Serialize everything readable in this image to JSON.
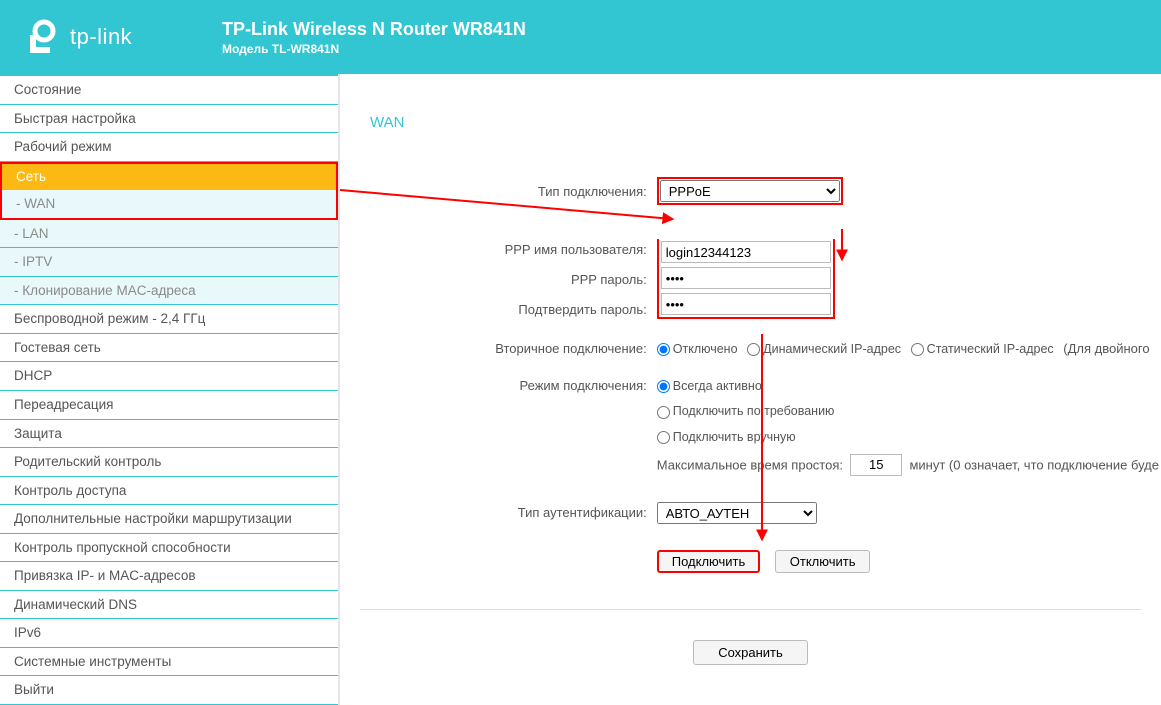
{
  "brand": {
    "logo_text": "tp-link"
  },
  "header": {
    "title": "TP-Link Wireless N Router WR841N",
    "subtitle": "Модель TL-WR841N"
  },
  "sidebar": {
    "items": {
      "status": "Состояние",
      "quick": "Быстрая настройка",
      "mode": "Рабочий режим",
      "net": "Сеть",
      "wan": "- WAN",
      "lan": "- LAN",
      "iptv": "- IPTV",
      "macclone": "- Клонирование MAC-адреса",
      "wireless": "Беспроводной режим - 2,4 ГГц",
      "guest": "Гостевая сеть",
      "dhcp": "DHCP",
      "fwd": "Переадресация",
      "sec": "Защита",
      "parent": "Родительский контроль",
      "access": "Контроль доступа",
      "route": "Дополнительные настройки маршрутизации",
      "bw": "Контроль пропускной способности",
      "bind": "Привязка IP- и MAC-адресов",
      "ddns": "Динамический DNS",
      "ipv6": "IPv6",
      "tools": "Системные инструменты",
      "logout": "Выйти"
    }
  },
  "wan": {
    "heading": "WAN",
    "labels": {
      "conn_type": "Тип подключения:",
      "ppp_user": "PPP имя пользователя:",
      "ppp_pass": "PPP пароль:",
      "ppp_conf": "Подтвердить пароль:",
      "secondary": "Вторичное подключение:",
      "conn_mode": "Режим подключения:",
      "idle": "Максимальное время простоя:",
      "idle_unit": "минут (0 означает, что подключение буде",
      "auth": "Тип аутентификации:"
    },
    "fields": {
      "conn_type_value": "PPPoE",
      "ppp_user_value": "login12344123",
      "ppp_pass_value": "••••",
      "ppp_conf_value": "••••",
      "idle_value": "15",
      "auth_value": "АВТО_АУТЕН"
    },
    "secondary_opts": {
      "off": "Отключено",
      "dyn": "Динамический IP-адрес",
      "stat": "Статический IP-адрес",
      "extra": "(Для двойного"
    },
    "mode_opts": {
      "always": "Всегда активно",
      "demand": "Подключить по требованию",
      "manual": "Подключить вручную"
    },
    "buttons": {
      "connect": "Подключить",
      "disconnect": "Отключить",
      "save": "Сохранить"
    }
  }
}
